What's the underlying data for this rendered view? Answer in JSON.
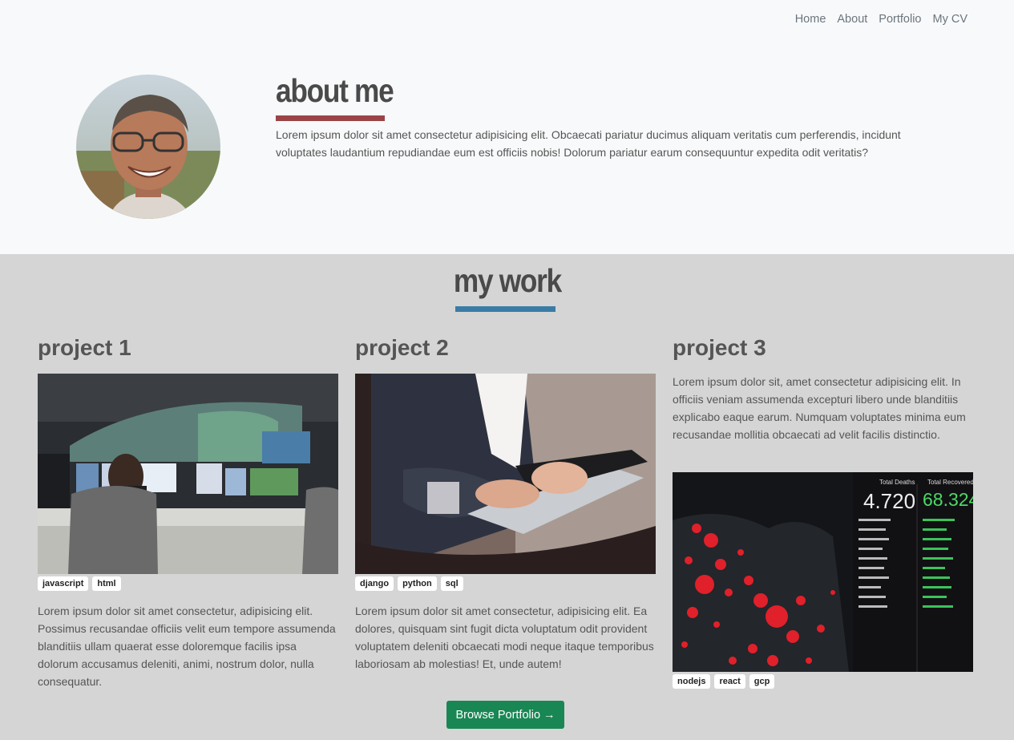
{
  "nav": {
    "items": [
      "Home",
      "About",
      "Portfolio",
      "My CV"
    ]
  },
  "about": {
    "title": "about me",
    "text": "Lorem ipsum dolor sit amet consectetur adipisicing elit. Obcaecati pariatur ducimus aliquam veritatis cum perferendis, incidunt voluptates laudantium repudiandae eum est officiis nobis! Dolorum pariatur earum consequuntur expedita odit veritatis?",
    "accent": "#9a4448"
  },
  "work": {
    "title": "my work",
    "accent": "#3a7ca5",
    "projects": [
      {
        "title": "project 1",
        "tags": [
          "javascript",
          "html"
        ],
        "text": "Lorem ipsum dolor sit amet consectetur, adipisicing elit. Possimus recusandae officiis velit eum tempore assumenda blanditiis ullam quaerat esse doloremque facilis ipsa dolorum accusamus deleniti, animi, nostrum dolor, nulla consequatur."
      },
      {
        "title": "project 2",
        "tags": [
          "django",
          "python",
          "sql"
        ],
        "text": "Lorem ipsum dolor sit amet consectetur, adipisicing elit. Ea dolores, quisquam sint fugit dicta voluptatum odit provident voluptatem deleniti obcaecati modi neque itaque temporibus laboriosam ab molestias! Et, unde autem!"
      },
      {
        "title": "project 3",
        "tags": [
          "nodejs",
          "react",
          "gcp"
        ],
        "text": "Lorem ipsum dolor sit, amet consectetur adipisicing elit. In officiis veniam assumenda excepturi libero unde blanditiis explicabo eaque earum. Numquam voluptates minima eum recusandae mollitia obcaecati ad velit facilis distinctio.",
        "dashboard": {
          "deaths_label": "Total Deaths",
          "deaths_value": "4.720",
          "recovered_label": "Total Recovered",
          "recovered_value": "68.324"
        }
      }
    ],
    "browse_label": "Browse Portfolio",
    "browse_color": "#198754"
  }
}
